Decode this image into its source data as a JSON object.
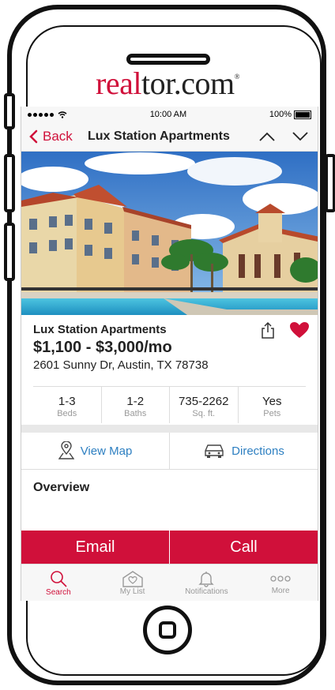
{
  "brand": {
    "logo_part1": "real",
    "logo_part2": "tor.com",
    "registered": "®"
  },
  "status_bar": {
    "time": "10:00 AM",
    "battery": "100%"
  },
  "nav": {
    "back_label": "Back",
    "title": "Lux Station Apartments"
  },
  "listing": {
    "name": "Lux Station Apartments",
    "price": "$1,100 - $3,000/mo",
    "address": "2601 Sunny Dr, Austin, TX 78738",
    "favorited": true
  },
  "specs": [
    {
      "value": "1-3",
      "label": "Beds"
    },
    {
      "value": "1-2",
      "label": "Baths"
    },
    {
      "value": "735-2262",
      "label": "Sq. ft."
    },
    {
      "value": "Yes",
      "label": "Pets"
    }
  ],
  "actions": {
    "view_map": "View Map",
    "directions": "Directions"
  },
  "section": {
    "overview": "Overview"
  },
  "cta": {
    "email": "Email",
    "call": "Call"
  },
  "tabs": [
    {
      "label": "Search",
      "icon": "search-icon",
      "active": true
    },
    {
      "label": "My List",
      "icon": "house-heart-icon",
      "active": false
    },
    {
      "label": "Notifications",
      "icon": "bell-icon",
      "active": false
    },
    {
      "label": "More",
      "icon": "more-dots-icon",
      "active": false
    }
  ],
  "colors": {
    "accent": "#d0103a",
    "link": "#2d7fc1"
  }
}
